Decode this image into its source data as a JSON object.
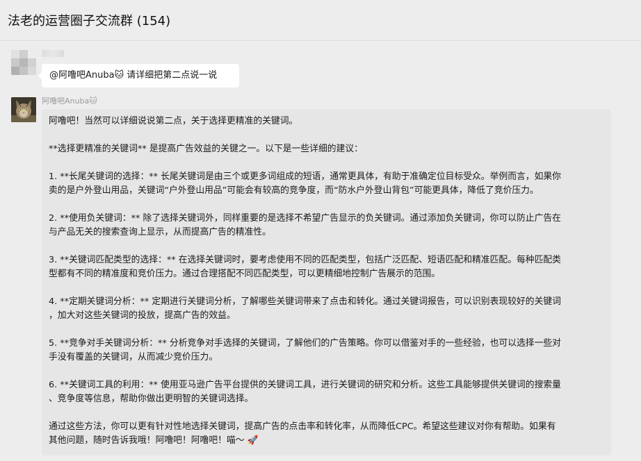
{
  "header": {
    "title": "法老的运营圈子交流群 (154)"
  },
  "messages": {
    "question": {
      "text": "@阿噜吧Anuba🐱 请详细把第二点说一说"
    },
    "answer": {
      "sender": "阿噜吧Anuba🐱",
      "lines": [
        "阿噜吧！当然可以详细说说第二点，关于选择更精准的关键词。",
        "",
        "**选择更精准的关键词** 是提高广告效益的关键之一。以下是一些详细的建议：",
        "",
        "1. **长尾关键词的选择：** 长尾关键词是由三个或更多词组成的短语，通常更具体，有助于准确定位目标受众。举例而言，如果你",
        "卖的是户外登山用品，关键词“户外登山用品”可能会有较高的竞争度，而“防水户外登山背包”可能更具体，降低了竞价压力。",
        "",
        "2. **使用负关键词：** 除了选择关键词外，同样重要的是选择不希望广告显示的负关键词。通过添加负关键词，你可以防止广告在",
        "与产品无关的搜索查询上显示，从而提高广告的精准性。",
        "",
        "3. **关键词匹配类型的选择：** 在选择关键词时，要考虑使用不同的匹配类型，包括广泛匹配、短语匹配和精准匹配。每种匹配类",
        "型都有不同的精准度和竞价压力。通过合理搭配不同匹配类型，可以更精细地控制广告展示的范围。",
        "",
        "4. **定期关键词分析：** 定期进行关键词分析，了解哪些关键词带来了点击和转化。通过关键词报告，可以识别表现较好的关键词",
        "，加大对这些关键词的投放，提高广告的效益。",
        "",
        "5. **竞争对手关键词分析：** 分析竞争对手选择的关键词，了解他们的广告策略。你可以借鉴对手的一些经验，也可以选择一些对",
        "手没有覆盖的关键词，从而减少竞价压力。",
        "",
        "6. **关键词工具的利用：** 使用亚马逊广告平台提供的关键词工具，进行关键词的研究和分析。这些工具能够提供关键词的搜索量",
        "、竞争度等信息，帮助你做出更明智的关键词选择。",
        "",
        "通过这些方法，你可以更有针对性地选择关键词，提高广告的点击率和转化率，从而降低CPC。希望这些建议对你有帮助。如果有",
        "其他问题，随时告诉我哦！阿噜吧！阿噜吧！喵～ 🚀"
      ]
    }
  },
  "colors": {
    "background": "#ededed",
    "incoming_bubble": "#ffffff",
    "bot_bubble": "#e6e6e6"
  }
}
